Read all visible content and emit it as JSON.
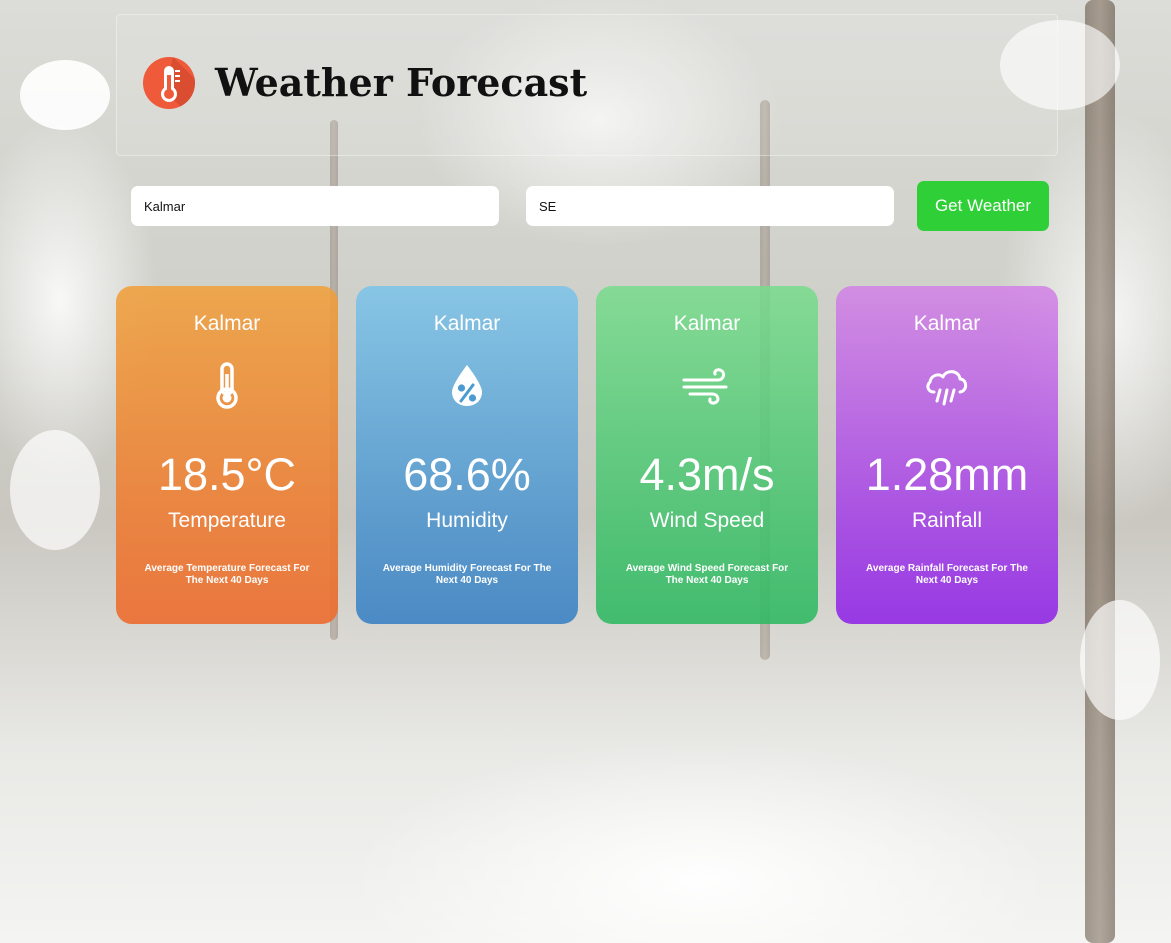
{
  "header": {
    "title": "Weather Forecast",
    "logo_icon": "thermometer-icon",
    "logo_color": "#ef5a3a"
  },
  "form": {
    "city_value": "Kalmar",
    "country_value": "SE",
    "submit_label": "Get Weather",
    "submit_color": "#2fcf37"
  },
  "cards": [
    {
      "city": "Kalmar",
      "icon": "thermometer-icon",
      "value": "18.5°C",
      "label": "Temperature",
      "note": "Average Temperature Forecast For The Next 40 Days",
      "color": "#eb8a3a"
    },
    {
      "city": "Kalmar",
      "icon": "humidity-drop-icon",
      "value": "68.6%",
      "label": "Humidity",
      "note": "Average Humidity Forecast For The Next 40 Days",
      "color": "#4b9bd0"
    },
    {
      "city": "Kalmar",
      "icon": "wind-icon",
      "value": "4.3m/s",
      "label": "Wind Speed",
      "note": "Average Wind Speed Forecast For The Next 40 Days",
      "color": "#3fc46e"
    },
    {
      "city": "Kalmar",
      "icon": "rain-cloud-icon",
      "value": "1.28mm",
      "label": "Rainfall",
      "note": "Average Rainfall Forecast For The Next 40 Days",
      "color": "#a14ae6"
    }
  ]
}
